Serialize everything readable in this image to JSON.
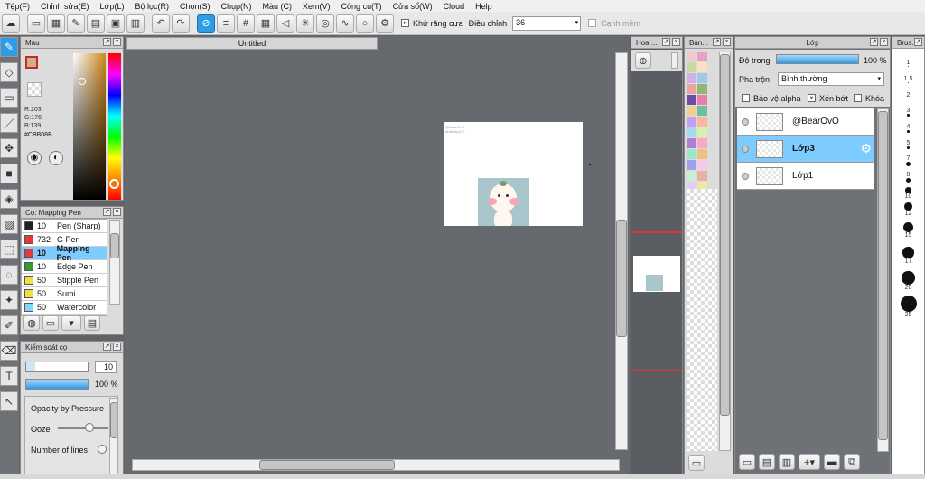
{
  "menu": [
    "Tệp(F)",
    "Chỉnh sửa(E)",
    "Lớp(L)",
    "Bộ lọc(R)",
    "Chọn(S)",
    "Chụp(N)",
    "Màu (C)",
    "Xem(V)",
    "Công cụ(T)",
    "Cửa sổ(W)",
    "Cloud",
    "Help"
  ],
  "toolbar": {
    "antialias_label": "Khử răng cưa",
    "adjust_label": "Điều chỉnh",
    "adjust_value": "36",
    "edge_label": "Cạnh mềm"
  },
  "canvas": {
    "tab_title": "Untitled",
    "watermark1": "@BearOvO",
    "watermark2": "#HeDap247"
  },
  "color": {
    "title": "Màu",
    "r": "R:203",
    "g": "G:176",
    "b": "B:139",
    "hex": "#CBB08B",
    "main_color": "#cbb08b"
  },
  "brush": {
    "title": "Cọ: Mapping Pen",
    "items": [
      {
        "size": "10",
        "name": "Pen (Sharp)",
        "color": "#222222"
      },
      {
        "size": "732",
        "name": "G Pen",
        "color": "#e53935"
      },
      {
        "size": "10",
        "name": "Mapping Pen",
        "color": "#e53935"
      },
      {
        "size": "10",
        "name": "Edge Pen",
        "color": "#2e9e2e"
      },
      {
        "size": "50",
        "name": "Stipple Pen",
        "color": "#f0e040"
      },
      {
        "size": "50",
        "name": "Sumi",
        "color": "#f0e040"
      },
      {
        "size": "50",
        "name": "Watercolor",
        "color": "#80d8ff"
      }
    ]
  },
  "control": {
    "title": "Kiểm soát cọ",
    "size_value": "10",
    "opacity_value": "100 %",
    "opacity_fill": 1.0,
    "pressure_label": "Opacity by Pressure",
    "ooze_label": "Ooze",
    "lines_label": "Number of lines"
  },
  "nav": {
    "title": "Hoa ..."
  },
  "swatch": {
    "title": "Bản...",
    "colors": [
      "#f4c6d0",
      "#e8a0c8",
      "#c8d8a0",
      "#f8e0c0",
      "#d0b0e8",
      "#a0c8e8",
      "#f0a0a0",
      "#90b870",
      "#6b4f9e",
      "#e87cb0",
      "#f0d090",
      "#70c0a0",
      "#c0a0f0",
      "#f8b8a0",
      "#a8d8f0",
      "#d8f0a8",
      "#b07cd8",
      "#f8a8c8",
      "#98e8c8",
      "#f0c080",
      "#a0a0e8",
      "#f8c8e8",
      "#c8f0d0",
      "#e8b0a0",
      "#e0d0f8",
      "#f0e8a0",
      "#90d0e0",
      "#f8b0b0",
      "#b8c8f0",
      "#d0e8b8",
      "#f8d8b0",
      "#c0b0e0",
      "#5f8fa0",
      "#e0e0e0",
      "#b0d0c0",
      "#a07850"
    ]
  },
  "layers": {
    "title": "Lớp",
    "opacity_label": "Độ trong",
    "opacity_value": "100 %",
    "opacity_fill": 1.0,
    "blend_label": "Pha trộn",
    "blend_value": "Bình thường",
    "protect_label": "Bảo vệ alpha",
    "clip_label": "Xén bớt",
    "lock_label": "Khóa",
    "items": [
      {
        "name": "@BearOvO"
      },
      {
        "name": "Lớp3"
      },
      {
        "name": "Lớp1"
      }
    ]
  },
  "brushsize": {
    "title": "Brus...",
    "sizes": [
      "1",
      "1.5",
      "2",
      "3",
      "4",
      "5",
      "7",
      "8",
      "10",
      "12",
      "15",
      "17",
      "20",
      "25"
    ]
  }
}
